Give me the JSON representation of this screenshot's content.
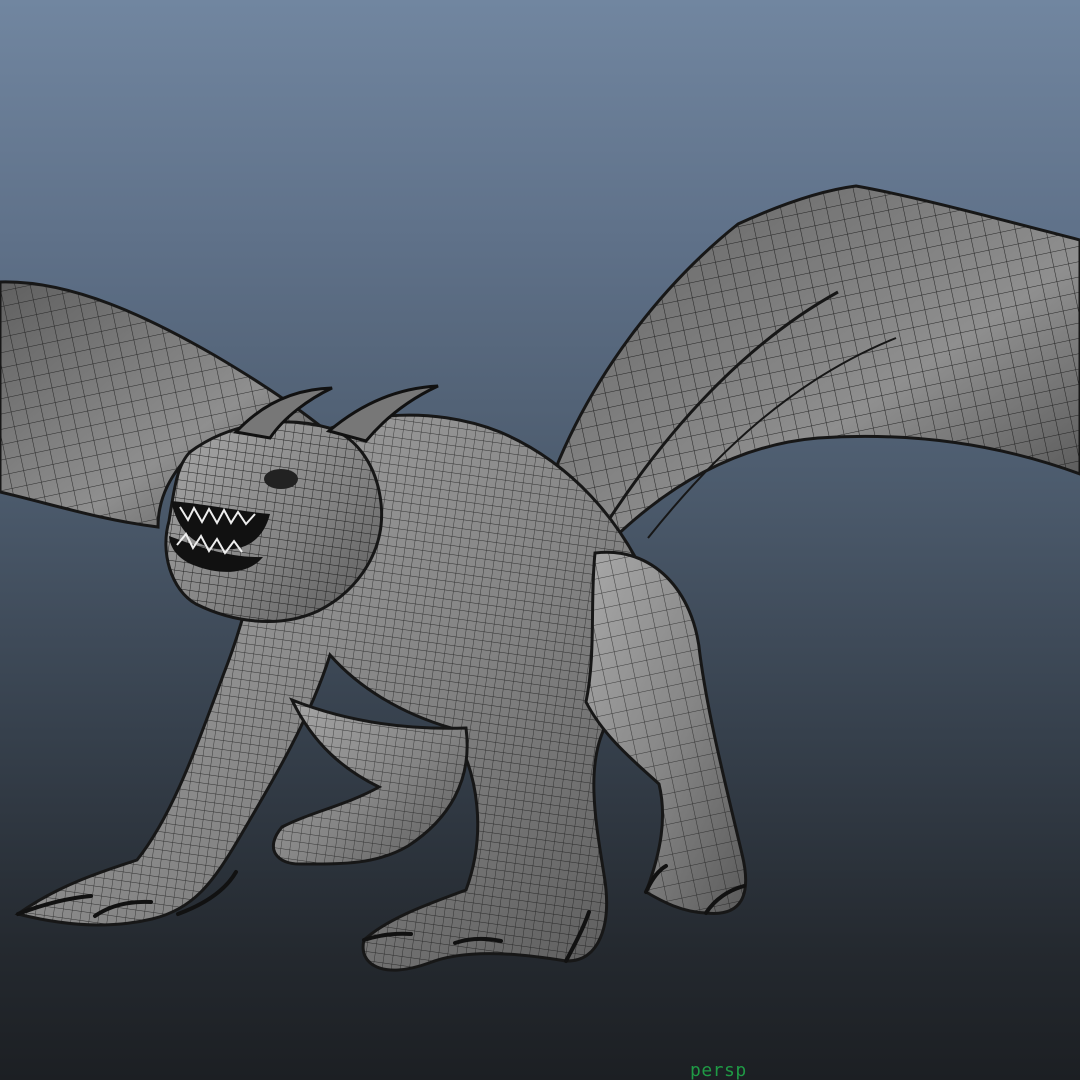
{
  "viewport": {
    "camera_label": "persp"
  },
  "icons": {
    "model": "dragon-wireframe-mesh-icon"
  },
  "colors": {
    "background_top": "#7186a0",
    "background_bottom": "#1c1f23",
    "camera_label": "#1f9a45",
    "mesh_fill": "#8c8c8c",
    "mesh_line": "#171717"
  }
}
